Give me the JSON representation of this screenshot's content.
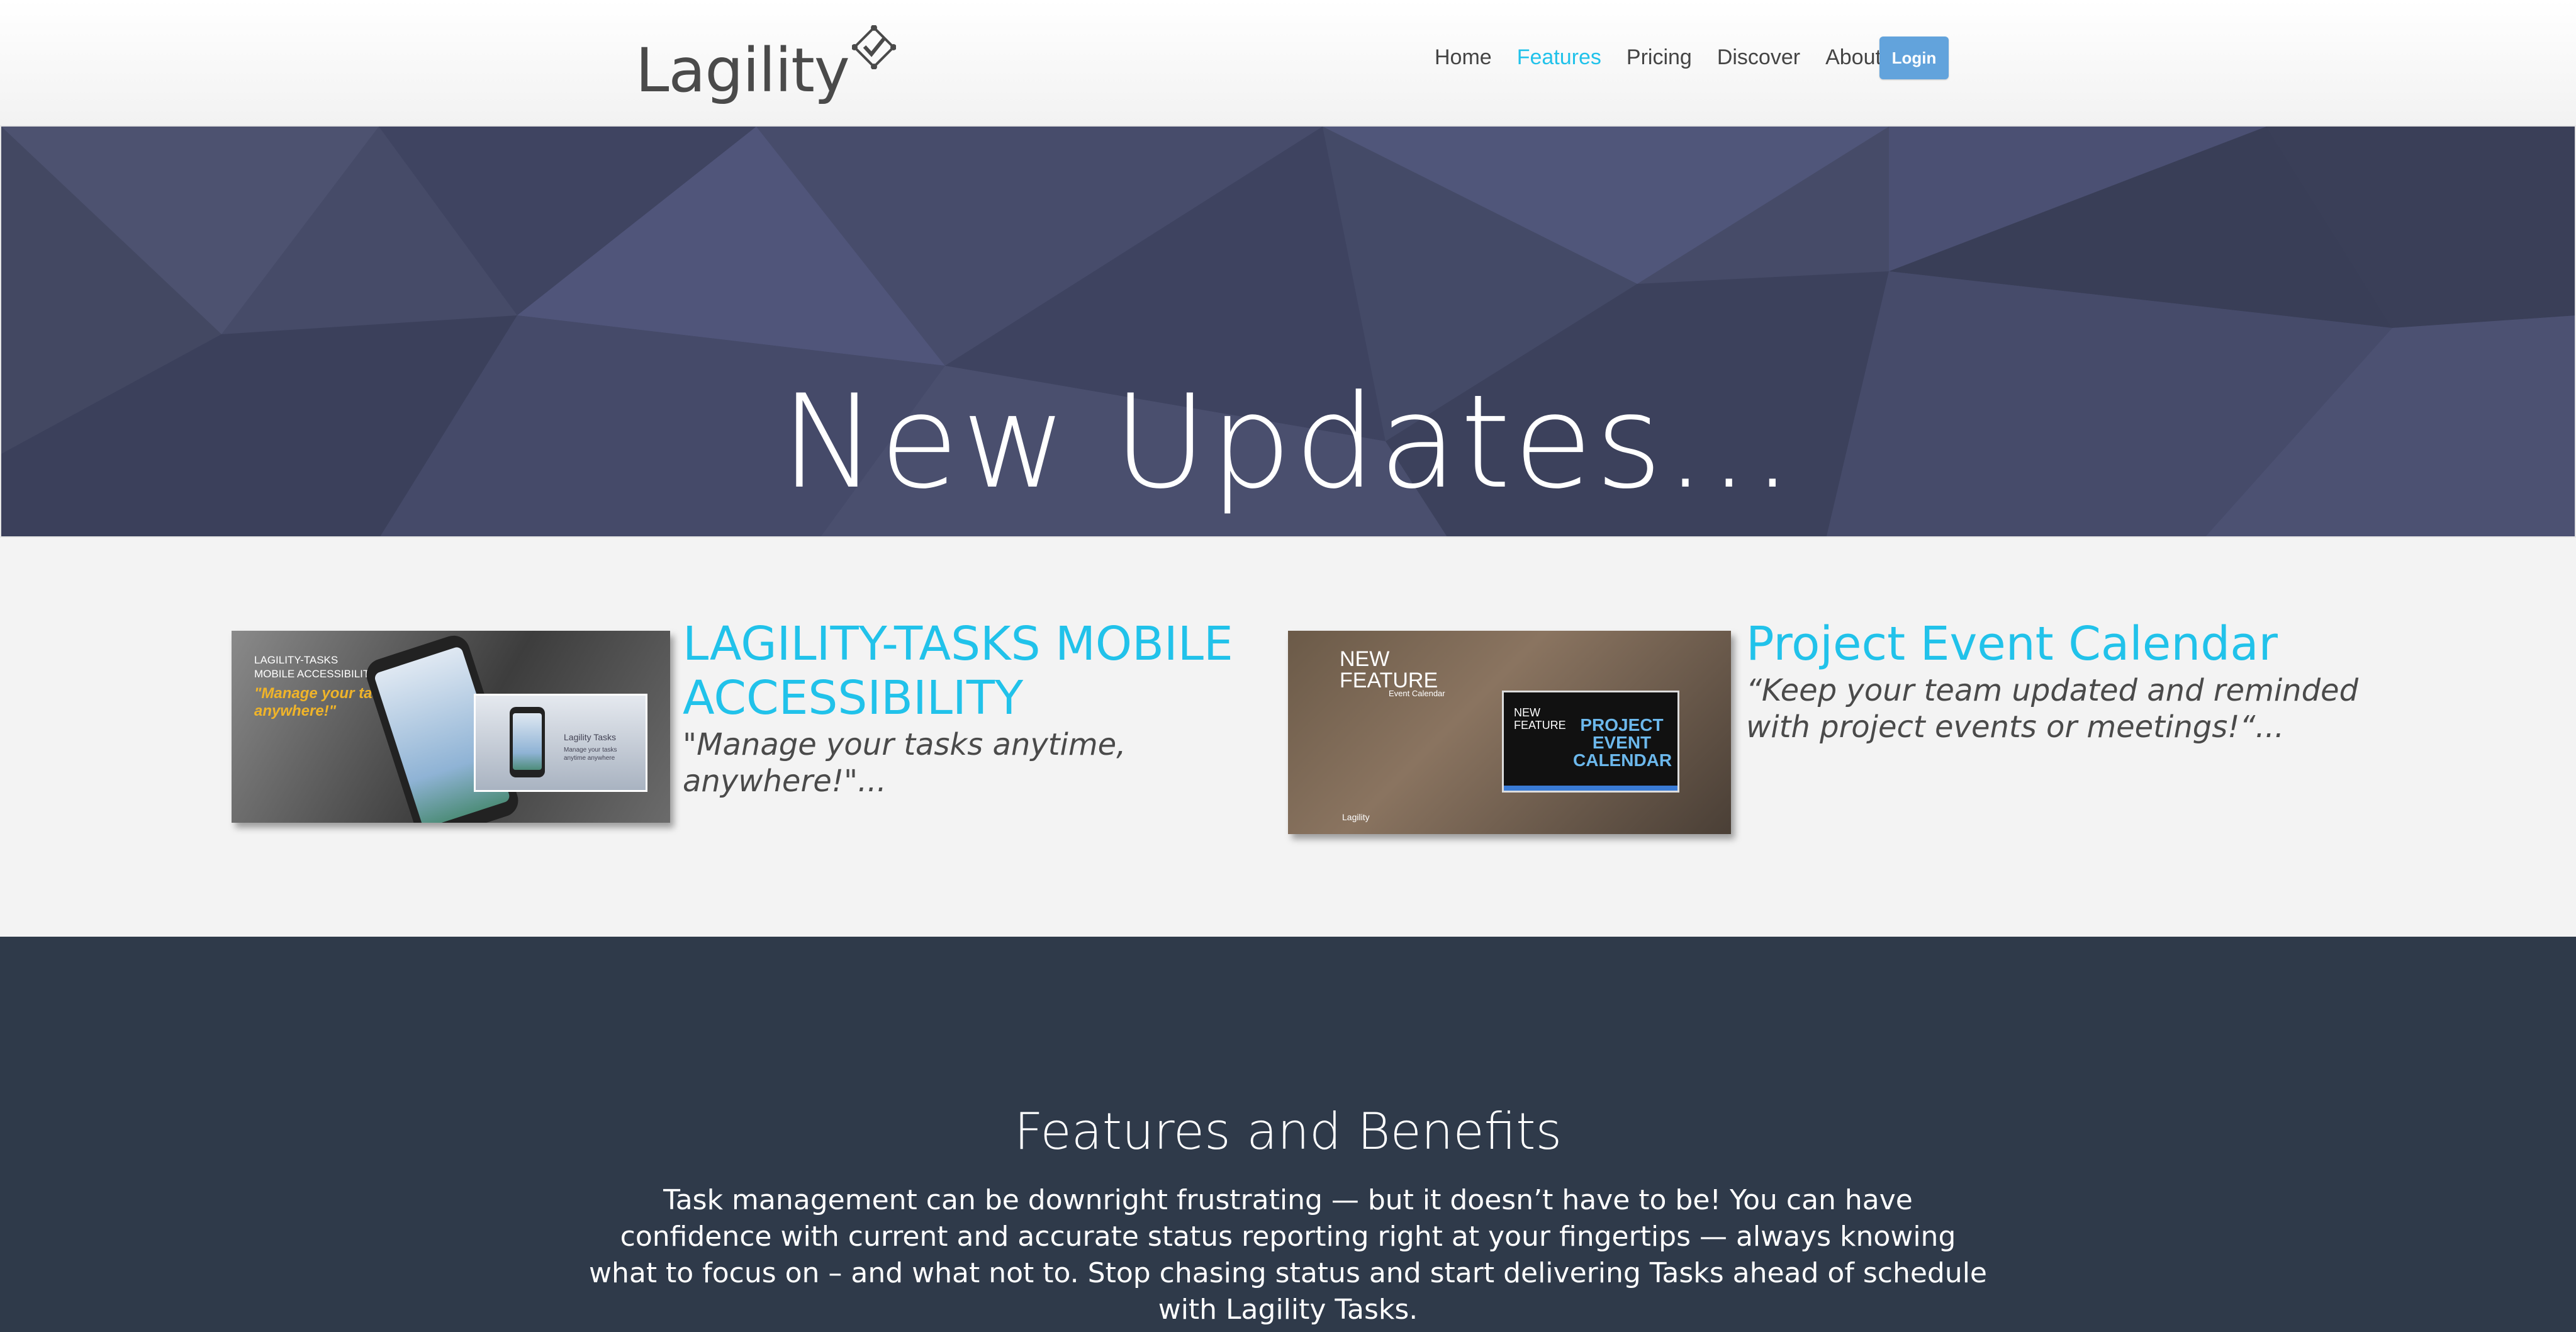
{
  "header": {
    "logo_text": "Lagility",
    "nav": [
      {
        "label": "Home",
        "active": false
      },
      {
        "label": "Features",
        "active": true
      },
      {
        "label": "Pricing",
        "active": false
      },
      {
        "label": "Discover",
        "active": false
      },
      {
        "label": "About",
        "active": false
      }
    ],
    "login_label": "Login"
  },
  "hero": {
    "title": "New Updates..."
  },
  "updates": [
    {
      "title": "LAGILITY-TASKS MOBILE ACCESSIBILITY",
      "quote": "\"Manage your tasks anytime, anywhere!\"...",
      "thumb": {
        "heading_line1": "LAGILITY-TASKS",
        "heading_line2": "MOBILE ACCESSIBILITY",
        "tagline": "\"Manage your tasks anytime, anywhere!\"",
        "popup_title": "Lagility Tasks",
        "popup_sub": "Manage your tasks anytime anywhere"
      }
    },
    {
      "title": "Project Event Calendar",
      "quote": "“Keep your team updated and reminded with project events or meetings!“...",
      "thumb": {
        "heading_line1": "NEW",
        "heading_line2": "FEATURE",
        "sub": "Event Calendar",
        "popup_new": "NEW FEATURE",
        "popup_title": "PROJECT EVENT CALENDAR",
        "brand": "Lagility"
      }
    }
  ],
  "features": {
    "title": "Features and Benefits",
    "body": "Task management can be downright frustrating — but it doesn’t have to be!   You can have confidence with current and accurate status reporting right at your fingertips — always knowing what to focus on – and what not to.  Stop chasing status and start delivering Tasks ahead of schedule with Lagility Tasks."
  },
  "colors": {
    "accent": "#21c2ea",
    "login_button": "#62a3dc",
    "hero_bg": "#464b68",
    "features_bg": "#2f3a4a"
  }
}
